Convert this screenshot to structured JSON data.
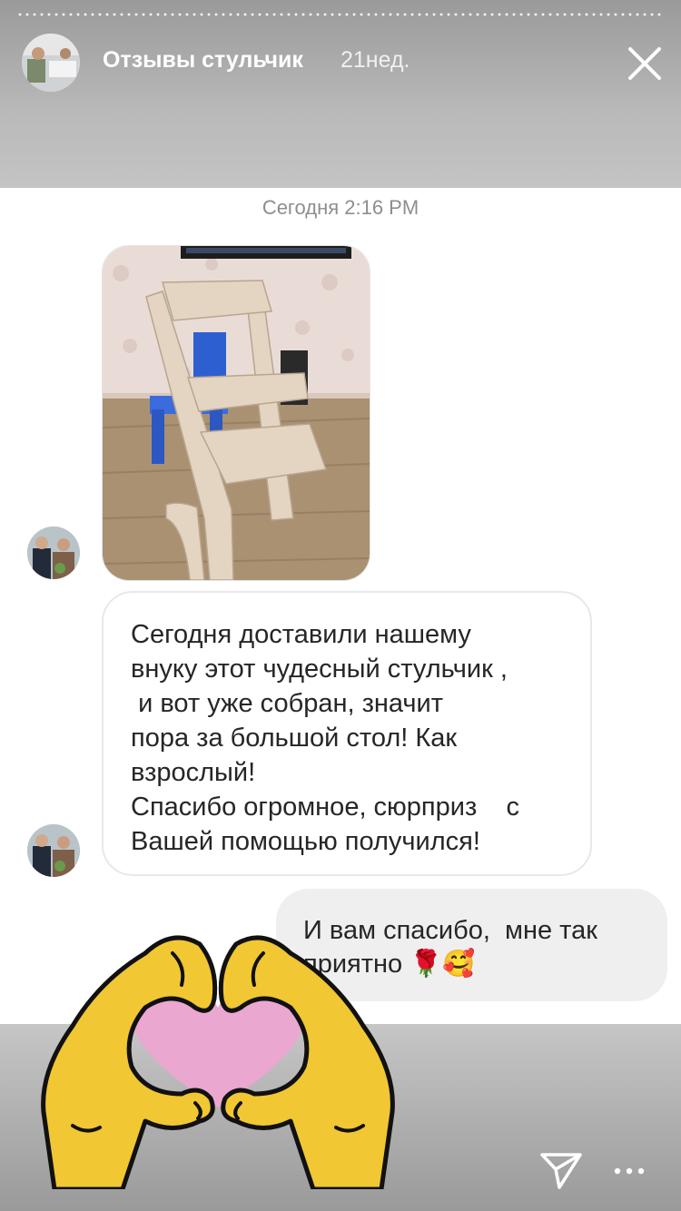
{
  "story": {
    "title": "Отзывы стульчик",
    "age": "21нед."
  },
  "chat": {
    "timestamp": "Сегодня 2:16 PM",
    "incoming_text": "Сегодня доставили нашему\nвнуку этот чудесный стульчик ,\n и вот уже собран, значит\nпора за большой стол! Как\nвзрослый!\nСпасибо огромное, сюрприз    с\nВашей помощью получился!",
    "outgoing_text": "И вам спасибо,  мне так\nприятно 🌹🥰"
  },
  "icons": {
    "close": "close-icon",
    "send": "send-icon",
    "more": "more-icon",
    "sticker": "heart-hands-sticker"
  },
  "colors": {
    "sticker_skin": "#f1c733",
    "sticker_heart": "#eaa7cf"
  }
}
